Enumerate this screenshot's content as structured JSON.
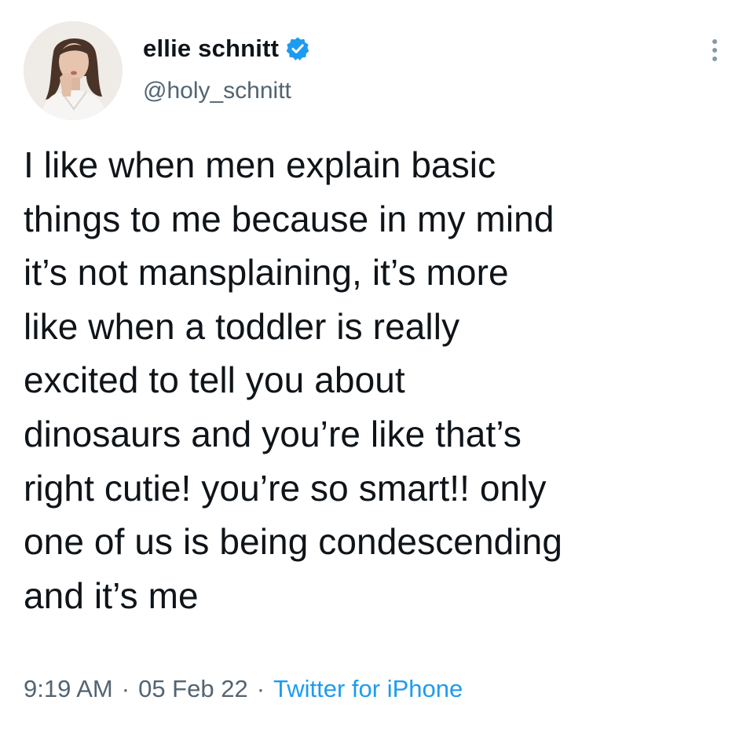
{
  "author": {
    "display_name": "ellie schnitt",
    "handle": "@holy_schnitt",
    "verified": true,
    "verified_icon": "verified-badge-icon",
    "avatar_icon": "profile-photo"
  },
  "menu": {
    "icon": "more-options-icon"
  },
  "tweet": {
    "lines": [
      "I like when men explain basic",
      "things to me because in my mind",
      "it’s not mansplaining, it’s more",
      "like when a toddler is really",
      "excited to tell you about",
      "dinosaurs and you’re like that’s",
      "right cutie! you’re so smart!! only",
      "one of us is being condescending",
      "and it’s me"
    ]
  },
  "meta": {
    "time": "9:19 AM",
    "separator": "·",
    "date": "05 Feb 22",
    "source": "Twitter for iPhone"
  },
  "colors": {
    "text": "#0f1419",
    "secondary": "#536471",
    "accent": "#1d9bf0"
  }
}
